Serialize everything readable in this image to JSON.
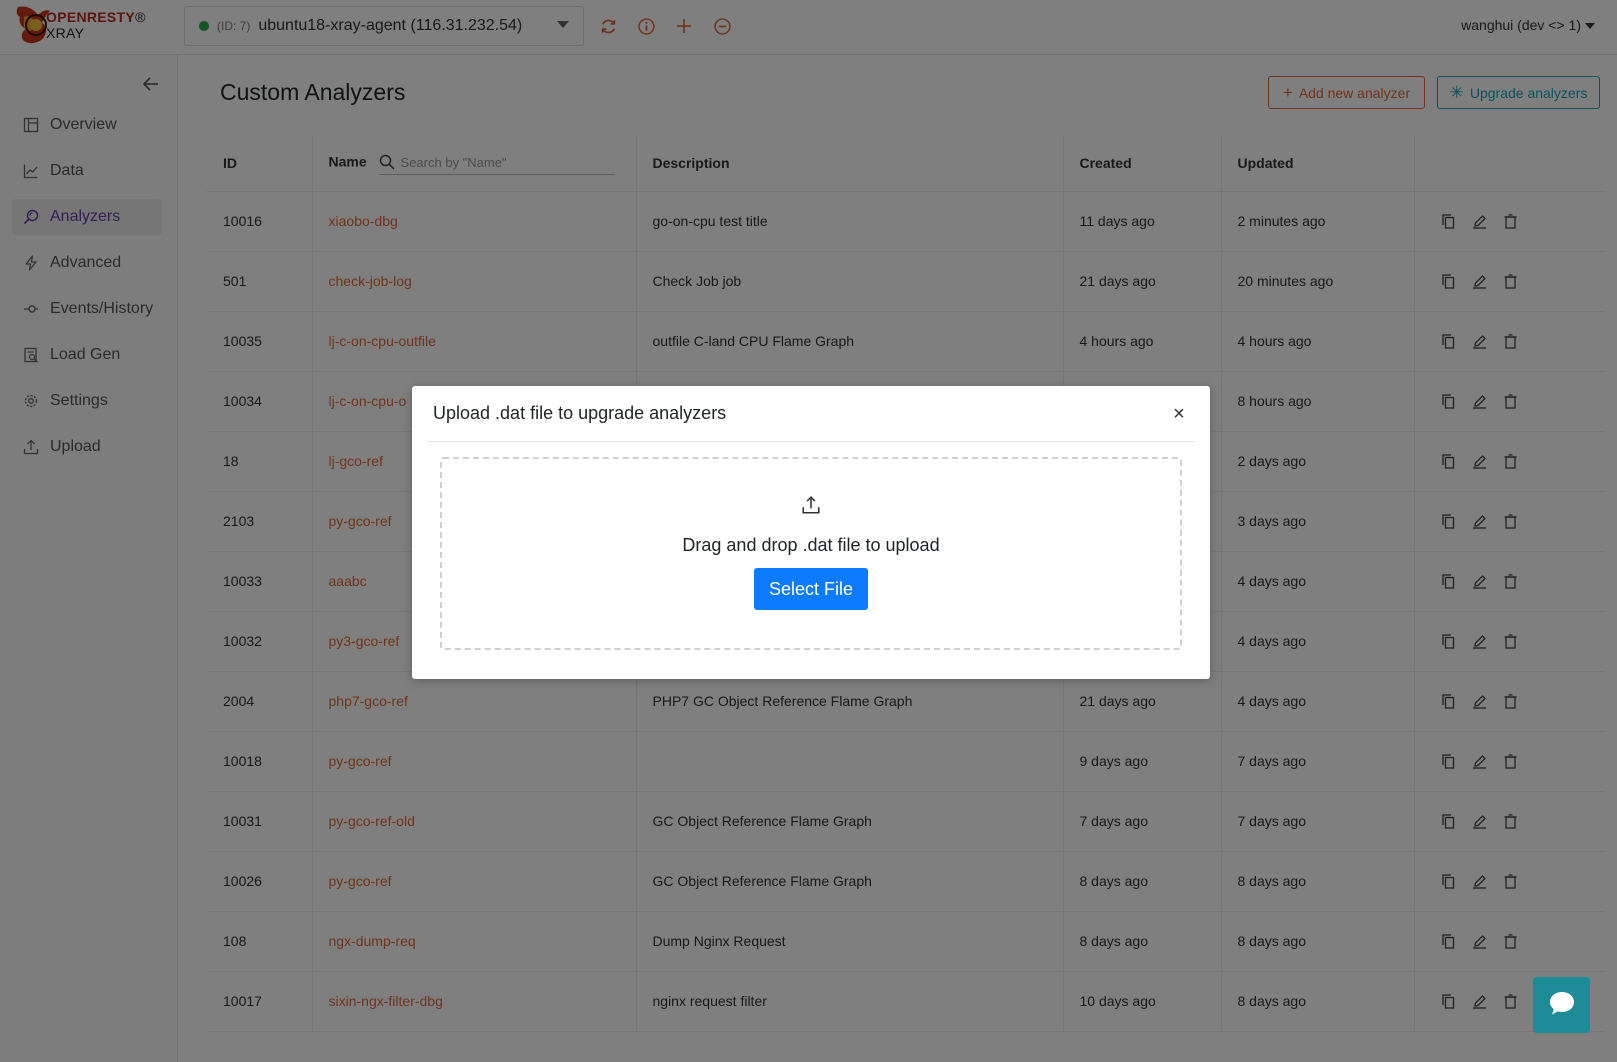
{
  "brand": {
    "logo_text_brand": "OPENRESTY",
    "logo_text_suffix": "® XRAY"
  },
  "agent": {
    "id_label": "(ID: 7)",
    "name": "ubuntu18-xray-agent (116.31.232.54)",
    "status_color": "#28a745"
  },
  "user": {
    "label": "wanghui (dev <> 1)"
  },
  "sidebar": {
    "items": [
      {
        "label": "Overview",
        "icon": "layout-icon"
      },
      {
        "label": "Data",
        "icon": "chart-icon"
      },
      {
        "label": "Analyzers",
        "icon": "analyzer-icon",
        "active": true
      },
      {
        "label": "Advanced",
        "icon": "lightning-icon"
      },
      {
        "label": "Events/History",
        "icon": "events-icon"
      },
      {
        "label": "Load Gen",
        "icon": "loadgen-icon"
      },
      {
        "label": "Settings",
        "icon": "gear-icon"
      },
      {
        "label": "Upload",
        "icon": "upload-icon"
      }
    ]
  },
  "page": {
    "title": "Custom Analyzers",
    "add_button": "Add new analyzer",
    "upgrade_button": "Upgrade analyzers"
  },
  "table": {
    "headers": {
      "id": "ID",
      "name": "Name",
      "description": "Description",
      "created": "Created",
      "updated": "Updated"
    },
    "search_placeholder": "Search by \"Name\"",
    "rows": [
      {
        "id": "10016",
        "name": "xiaobo-dbg",
        "description": "go-on-cpu test title",
        "created": "11 days ago",
        "updated": "2 minutes ago"
      },
      {
        "id": "501",
        "name": "check-job-log",
        "description": "Check Job job",
        "created": "21 days ago",
        "updated": "20 minutes ago"
      },
      {
        "id": "10035",
        "name": "lj-c-on-cpu-outfile",
        "description": "outfile C-land CPU Flame Graph",
        "created": "4 hours ago",
        "updated": "4 hours ago"
      },
      {
        "id": "10034",
        "name": "lj-c-on-cpu-o",
        "description": "",
        "created": "",
        "updated": "8 hours ago"
      },
      {
        "id": "18",
        "name": "lj-gco-ref",
        "description": "",
        "created": "",
        "updated": "2 days ago"
      },
      {
        "id": "2103",
        "name": "py-gco-ref",
        "description": "",
        "created": "",
        "updated": "3 days ago"
      },
      {
        "id": "10033",
        "name": "aaabc",
        "description": "",
        "created": "",
        "updated": "4 days ago"
      },
      {
        "id": "10032",
        "name": "py3-gco-ref",
        "description": "",
        "created": "",
        "updated": "4 days ago"
      },
      {
        "id": "2004",
        "name": "php7-gco-ref",
        "description": "PHP7 GC Object Reference Flame Graph",
        "created": "21 days ago",
        "updated": "4 days ago"
      },
      {
        "id": "10018",
        "name": "py-gco-ref",
        "description": "",
        "created": "9 days ago",
        "updated": "7 days ago"
      },
      {
        "id": "10031",
        "name": "py-gco-ref-old",
        "description": "GC Object Reference Flame Graph",
        "created": "7 days ago",
        "updated": "7 days ago"
      },
      {
        "id": "10026",
        "name": "py-gco-ref",
        "description": "GC Object Reference Flame Graph",
        "created": "8 days ago",
        "updated": "8 days ago"
      },
      {
        "id": "108",
        "name": "ngx-dump-req",
        "description": "Dump Nginx Request",
        "created": "8 days ago",
        "updated": "8 days ago"
      },
      {
        "id": "10017",
        "name": "sixin-ngx-filter-dbg",
        "description": "nginx request filter",
        "created": "10 days ago",
        "updated": "8 days ago"
      }
    ]
  },
  "modal": {
    "title": "Upload .dat file to upgrade analyzers",
    "close": "×",
    "drop_text": "Drag and drop .dat file to upload",
    "select_button": "Select File"
  },
  "colors": {
    "accent_orange": "#e06734",
    "accent_teal": "#17a2b8",
    "primary_blue": "#0d7bff",
    "active_nav": "#6a3aa8",
    "chat_button": "#1d8c96"
  }
}
